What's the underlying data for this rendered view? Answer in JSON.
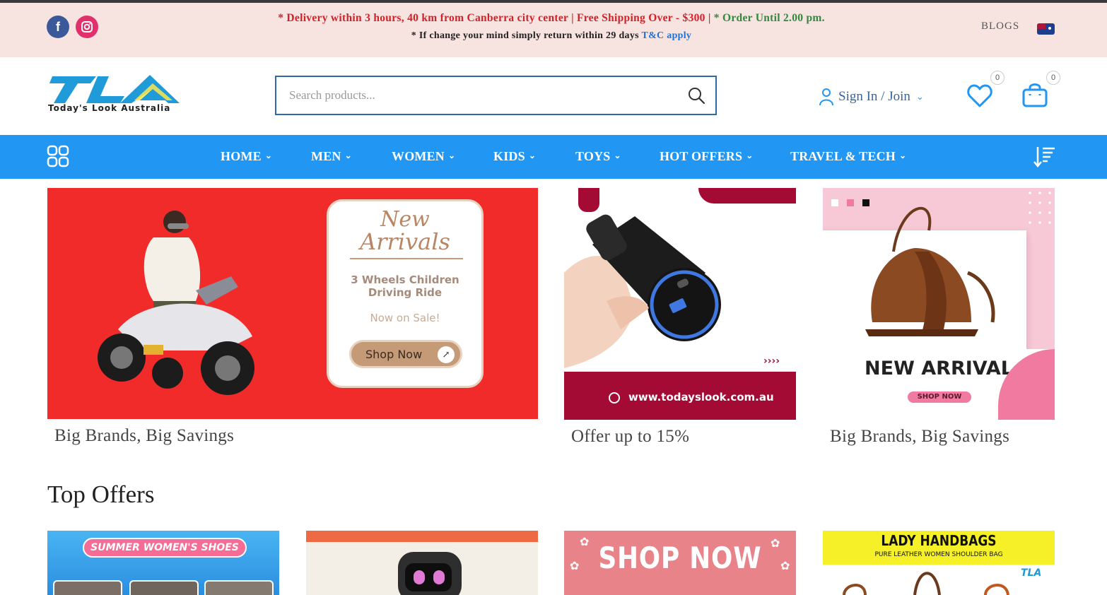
{
  "topbar": {
    "announce_1a": "* Delivery within 3 hours, 40 km from Canberra city center | Free Shipping Over - $300 |",
    "announce_1b": "* Order Until 2.00 pm.",
    "announce_2a": "* If change your mind simply return within 29 days",
    "announce_2b": "T&C apply",
    "blogs": "BLOGS",
    "social": [
      "facebook-icon",
      "instagram-icon"
    ]
  },
  "header": {
    "logo_text": "TLA",
    "logo_subtitle": "Today's Look Australia",
    "search_placeholder": "Search products...",
    "signin_label": "Sign In / Join",
    "wishlist_count": "0",
    "cart_count": "0"
  },
  "nav": {
    "items": [
      {
        "label": "HOME"
      },
      {
        "label": "MEN"
      },
      {
        "label": "WOMEN"
      },
      {
        "label": "KIDS"
      },
      {
        "label": "TOYS"
      },
      {
        "label": "HOT OFFERS"
      },
      {
        "label": "TRAVEL & TECH"
      }
    ]
  },
  "banners": [
    {
      "heading_1": "New",
      "heading_2": "Arrivals",
      "line_1": "3 Wheels Children",
      "line_2": "Driving Ride",
      "sale": "Now on Sale!",
      "cta": "Shop Now",
      "caption": "Big Brands, Big Savings"
    },
    {
      "url": "www.todayslook.com.au",
      "arrows": "››››",
      "caption": "Offer up to 15%"
    },
    {
      "heading": "NEW ARRIVAL",
      "cta": "SHOP NOW",
      "caption": "Big Brands, Big Savings"
    }
  ],
  "top_offers": {
    "title": "Top Offers",
    "cards": [
      {
        "text": "SUMMER WOMEN'S SHOES"
      },
      {
        "text": ""
      },
      {
        "text": "SHOP NOW"
      },
      {
        "text": "LADY HANDBAGS",
        "subtext": "PURE LEATHER WOMEN SHOULDER BAG",
        "logo": "TLA"
      }
    ]
  },
  "colors": {
    "nav_blue": "#2196f3",
    "topbar_bg": "#f7e4e1",
    "announce_red": "#d42027",
    "announce_green": "#2f8a3c",
    "link_blue": "#1e73d6"
  }
}
